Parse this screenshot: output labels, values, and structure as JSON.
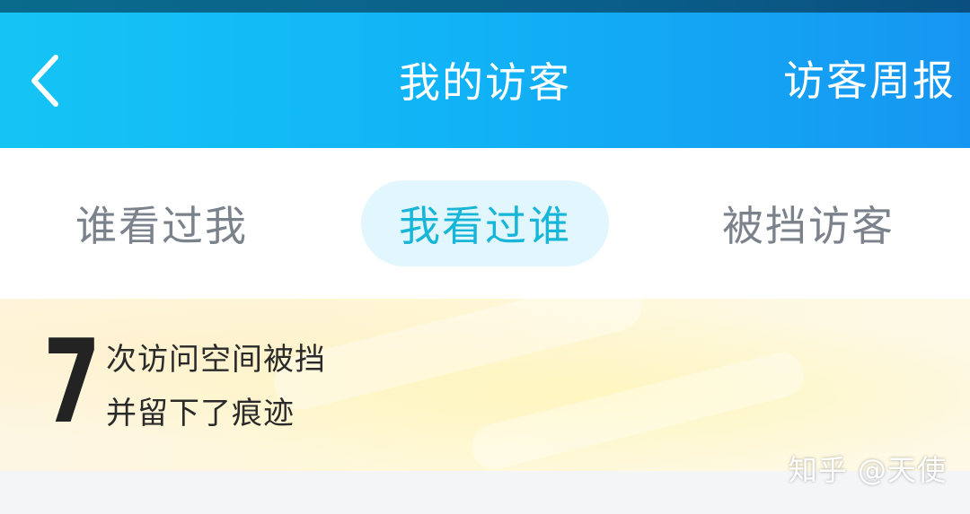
{
  "header": {
    "back_icon": "chevron-left-icon",
    "title": "我的访客",
    "action_label": "访客周报"
  },
  "tabs": [
    {
      "label": "谁看过我",
      "selected": false
    },
    {
      "label": "我看过谁",
      "selected": true
    },
    {
      "label": "被挡访客",
      "selected": false
    }
  ],
  "banner": {
    "count": "7",
    "line1": "次访问空间被挡",
    "line2": "并留下了痕迹"
  },
  "watermark": "知乎 @天使",
  "colors": {
    "header_start": "#15c4f5",
    "header_end": "#1696f2",
    "tab_selected_bg": "#e2f6fd",
    "tab_selected_text": "#17b6d8",
    "tab_text": "#7b828c"
  }
}
